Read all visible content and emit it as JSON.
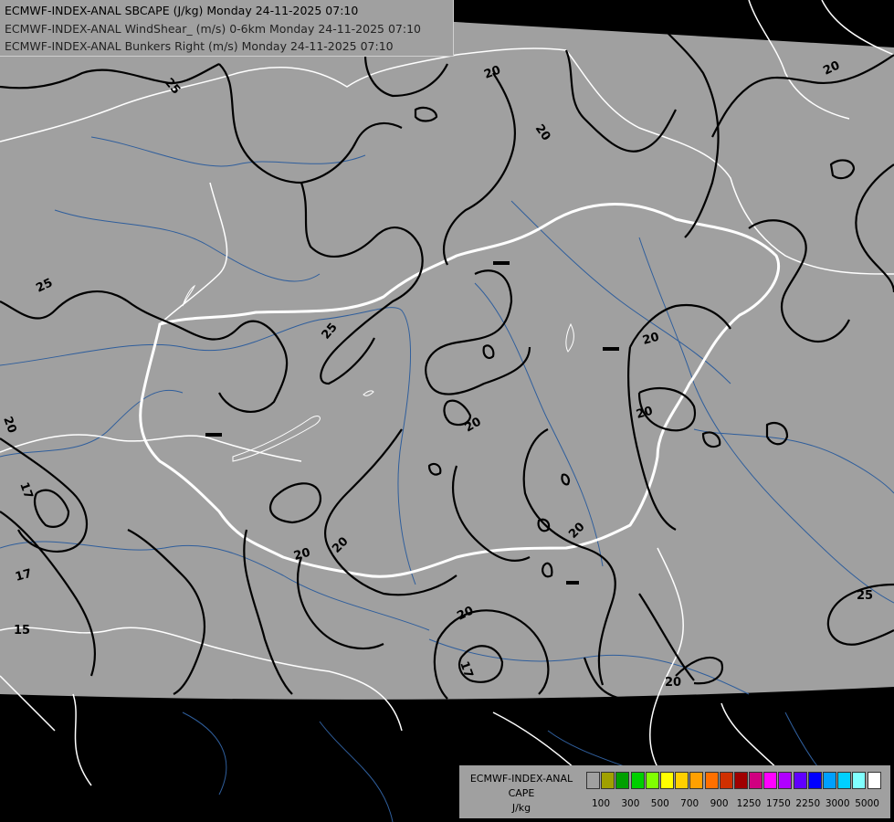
{
  "header": {
    "line1": "ECMWF-INDEX-ANAL SBCAPE (J/kg) Monday 24-11-2025 07:10",
    "line2": "ECMWF-INDEX-ANAL WindShear_ (m/s) 0-6km Monday 24-11-2025 07:10",
    "line3": "ECMWF-INDEX-ANAL Bunkers Right (m/s) Monday 24-11-2025 07:10"
  },
  "contour_labels": [
    "20",
    "20",
    "20",
    "25",
    "25",
    "25",
    "25",
    "20",
    "20",
    "20",
    "20",
    "20",
    "20",
    "20",
    "20",
    "17",
    "17",
    "17",
    "15",
    "20"
  ],
  "legend": {
    "source": "ECMWF-INDEX-ANAL",
    "param": "CAPE",
    "unit": "J/kg",
    "colors": [
      "#a0a0a0",
      "#a0a000",
      "#00a000",
      "#00d000",
      "#80ff00",
      "#ffff00",
      "#ffd000",
      "#ffa000",
      "#ff7000",
      "#d03000",
      "#a00000",
      "#d00080",
      "#ff00ff",
      "#b000ff",
      "#6000ff",
      "#0000ff",
      "#00a0ff",
      "#00d0ff",
      "#80ffff",
      "#ffffff"
    ],
    "ticks": [
      "100",
      "300",
      "500",
      "700",
      "900",
      "1250",
      "1750",
      "2250",
      "3000",
      "5000"
    ]
  },
  "colors": {
    "land": "#a0a0a0",
    "outside": "#000000",
    "contour": "#000000",
    "border": "#ffffff",
    "river": "#2f5e9c"
  }
}
